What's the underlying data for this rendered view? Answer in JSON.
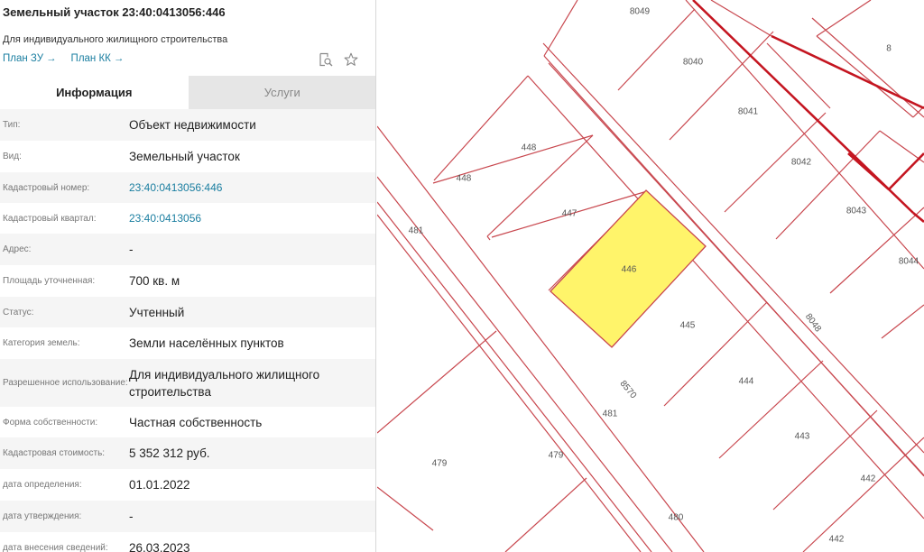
{
  "header": {
    "title": "Земельный участок 23:40:0413056:446",
    "subtitle": "Для индивидуального жилищного строительства",
    "links": [
      {
        "label": "План ЗУ",
        "arrow": "→"
      },
      {
        "label": "План КК",
        "arrow": "→"
      }
    ],
    "icons": [
      "search-document-icon",
      "star-icon"
    ]
  },
  "tabs": [
    {
      "label": "Информация",
      "active": true
    },
    {
      "label": "Услуги",
      "active": false
    }
  ],
  "info_rows": [
    {
      "label": "Тип:",
      "value": "Объект недвижимости"
    },
    {
      "label": "Вид:",
      "value": "Земельный участок"
    },
    {
      "label": "Кадастровый номер:",
      "value": "23:40:0413056:446",
      "link": true
    },
    {
      "label": "Кадастровый квартал:",
      "value": "23:40:0413056",
      "link": true
    },
    {
      "label": "Адрес:",
      "value": "-"
    },
    {
      "label": "Площадь уточненная:",
      "value": "700 кв. м"
    },
    {
      "label": "Статус:",
      "value": "Учтенный"
    },
    {
      "label": "Категория земель:",
      "value": "Земли населённых пунктов"
    },
    {
      "label": "Разрешенное использование:",
      "value": "Для индивидуального жилищного строительства"
    },
    {
      "label": "Форма собственности:",
      "value": "Частная собственность"
    },
    {
      "label": "Кадастровая стоимость:",
      "value": "5 352 312 руб."
    },
    {
      "label": "дата определения:",
      "value": "01.01.2022"
    },
    {
      "label": "дата утверждения:",
      "value": "-"
    },
    {
      "label": "дата внесения сведений:",
      "value": "26.03.2023"
    }
  ],
  "map": {
    "parcel_labels": [
      "8049",
      "8",
      "8040",
      "8041",
      "8042",
      "8043",
      "8044",
      "448",
      "448",
      "447",
      "446",
      "445",
      "444",
      "443",
      "442",
      "442",
      "481",
      "481",
      "479",
      "479",
      "480",
      "8570",
      "8048"
    ],
    "colors": {
      "parcel_line": "#c8474e",
      "boundary_line": "#c41520",
      "selected_fill": "#fff46a"
    }
  }
}
